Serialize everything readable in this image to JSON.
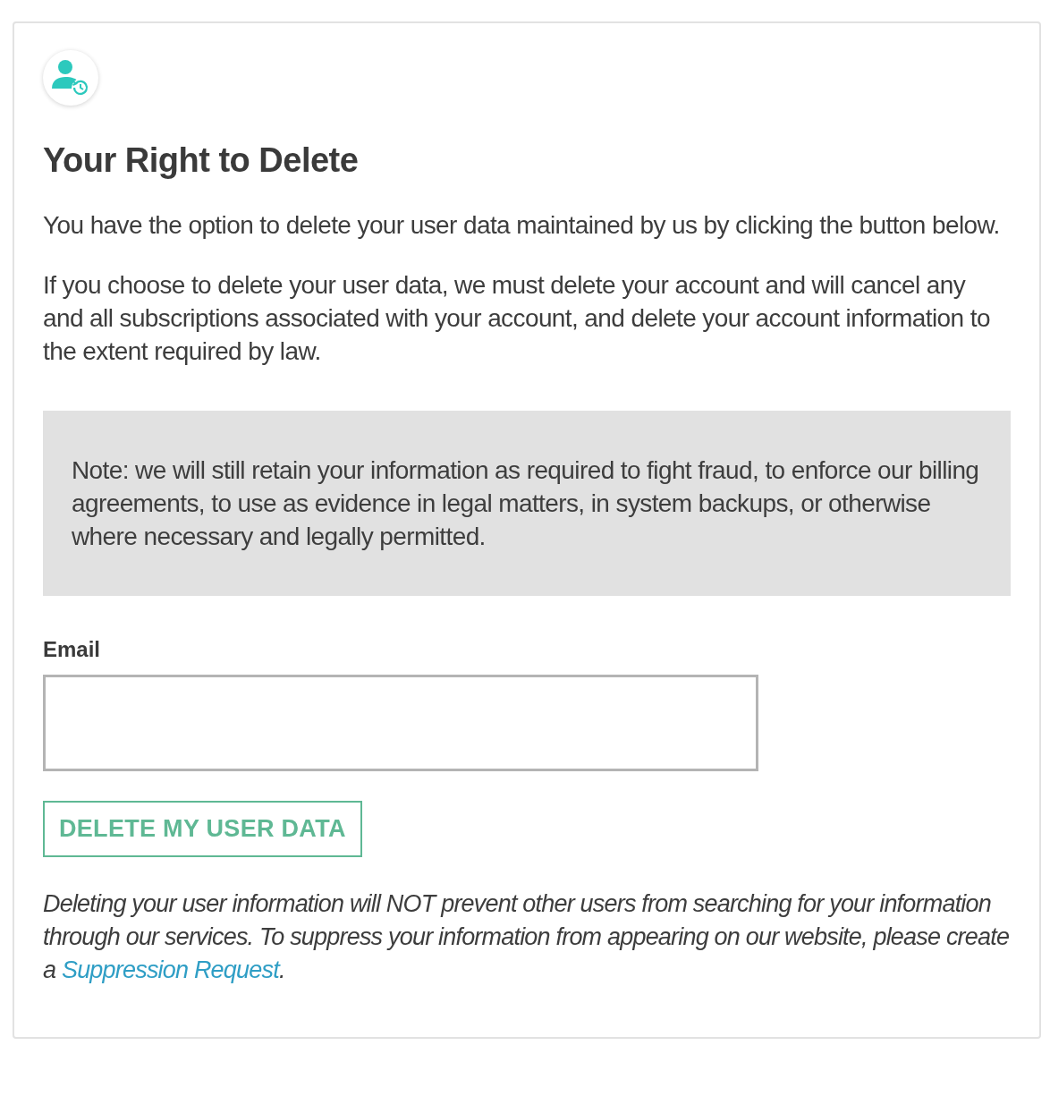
{
  "title": "Your Right to Delete",
  "paragraphs": [
    "You have the option to delete your user data maintained by us by clicking the button below.",
    "If you choose to delete your user data, we must delete your account and will cancel any and all subscriptions associated with your account, and delete your account information to the extent required by law."
  ],
  "note": "Note: we will still retain your information as required to fight fraud, to enforce our billing agreements, to use as evidence in legal matters, in system backups, or otherwise where necessary and legally permitted.",
  "email_field": {
    "label": "Email"
  },
  "button": "DELETE MY USER DATA",
  "disclaimer": {
    "text": "Deleting your user information will NOT prevent other users from searching for your information through our services. To suppress your information from appearing on our website, please create a ",
    "link": "Suppression Request",
    "after": "."
  }
}
